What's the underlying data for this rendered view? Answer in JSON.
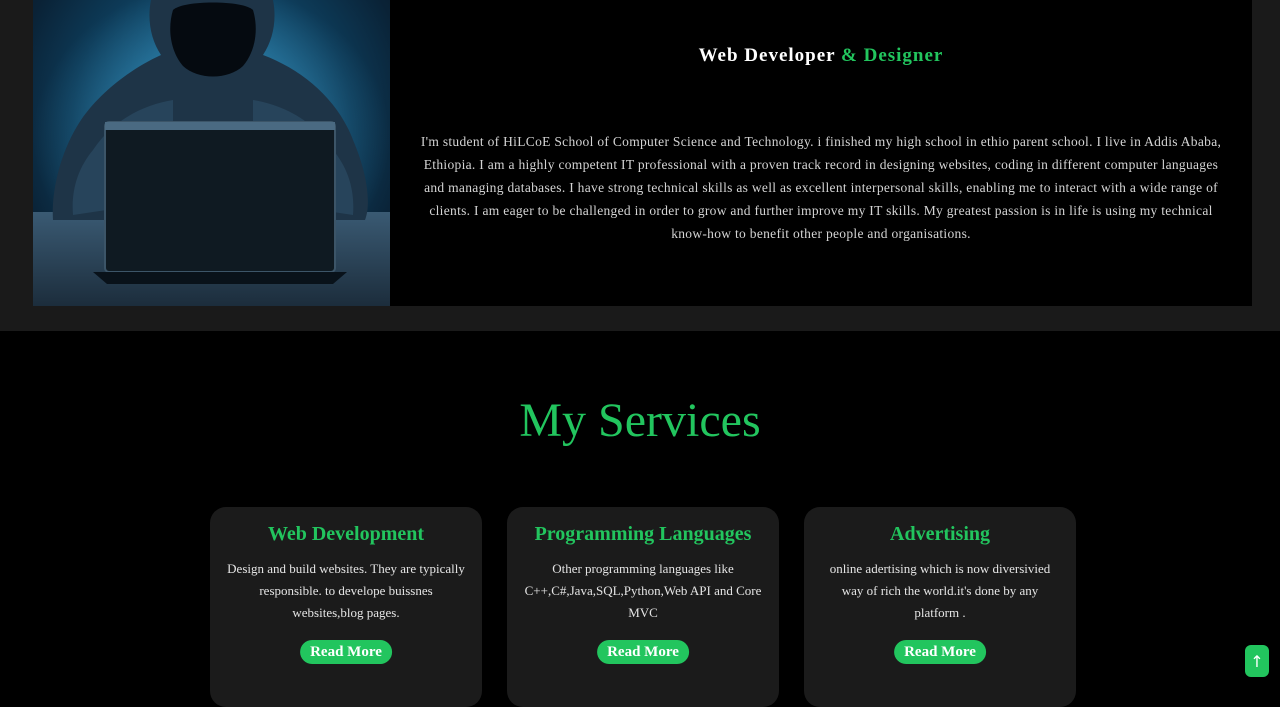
{
  "about": {
    "role_prefix": "Web Developer ",
    "role_accent": "& Designer",
    "bio": "I'm student of HiLCoE School of Computer Science and Technology. i finished my high school in ethio parent school. I live in Addis Ababa, Ethiopia. I am a highly competent IT professional with a proven track record in designing websites, coding in different computer languages and managing databases. I have strong technical skills as well as excellent interpersonal skills, enabling me to interact with a wide range of clients. I am eager to be challenged in order to grow and further improve my IT skills. My greatest passion is in life is using my technical know-how to benefit other people and organisations."
  },
  "services": {
    "title": "My Services",
    "cards": [
      {
        "title": "Web Development",
        "description": "Design and build websites. They are typically responsible. to develope buissnes websites,blog pages.",
        "button": "Read More"
      },
      {
        "title": "Programming Languages",
        "description": "Other programming languages like C++,C#,Java,SQL,Python,Web API and Core MVC",
        "button": "Read More"
      },
      {
        "title": "Advertising",
        "description": "online adertising which is now diversivied way of rich the world.it's done by any platform .",
        "button": "Read More"
      }
    ]
  },
  "scroll_top": {
    "icon": "arrow-up-icon",
    "glyph": "↑"
  },
  "colors": {
    "accent": "#22c55e",
    "background": "#000000",
    "band": "#1a1a1a",
    "card": "#1b1b1b"
  }
}
